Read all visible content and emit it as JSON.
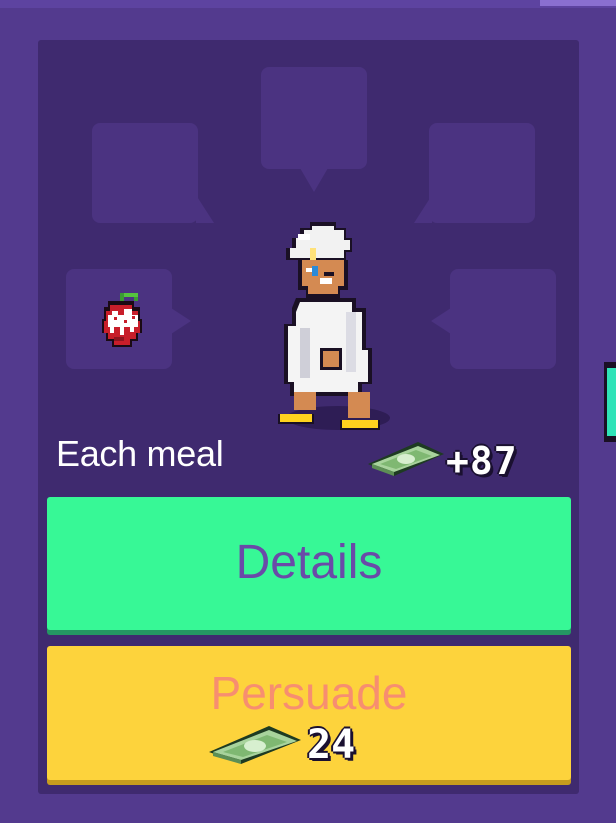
{
  "card": {
    "caption": "Each meal",
    "income_value": "+87",
    "income_icon": "cash-bill-icon",
    "food_icon": "strawberry-icon",
    "character": "chef-customer-sprite"
  },
  "buttons": {
    "details_label": "Details",
    "persuade_label": "Persuade",
    "persuade_cost": "24",
    "cost_icon": "cash-bill-icon"
  },
  "colors": {
    "background": "#533a8e",
    "card": "#3f2a6f",
    "slot": "#4b3381",
    "details_button": "#37f896",
    "details_text": "#6a4aa8",
    "persuade_button": "#fdd33c",
    "persuade_text": "#f78e70",
    "next_arrow": "#2fe3b8"
  }
}
